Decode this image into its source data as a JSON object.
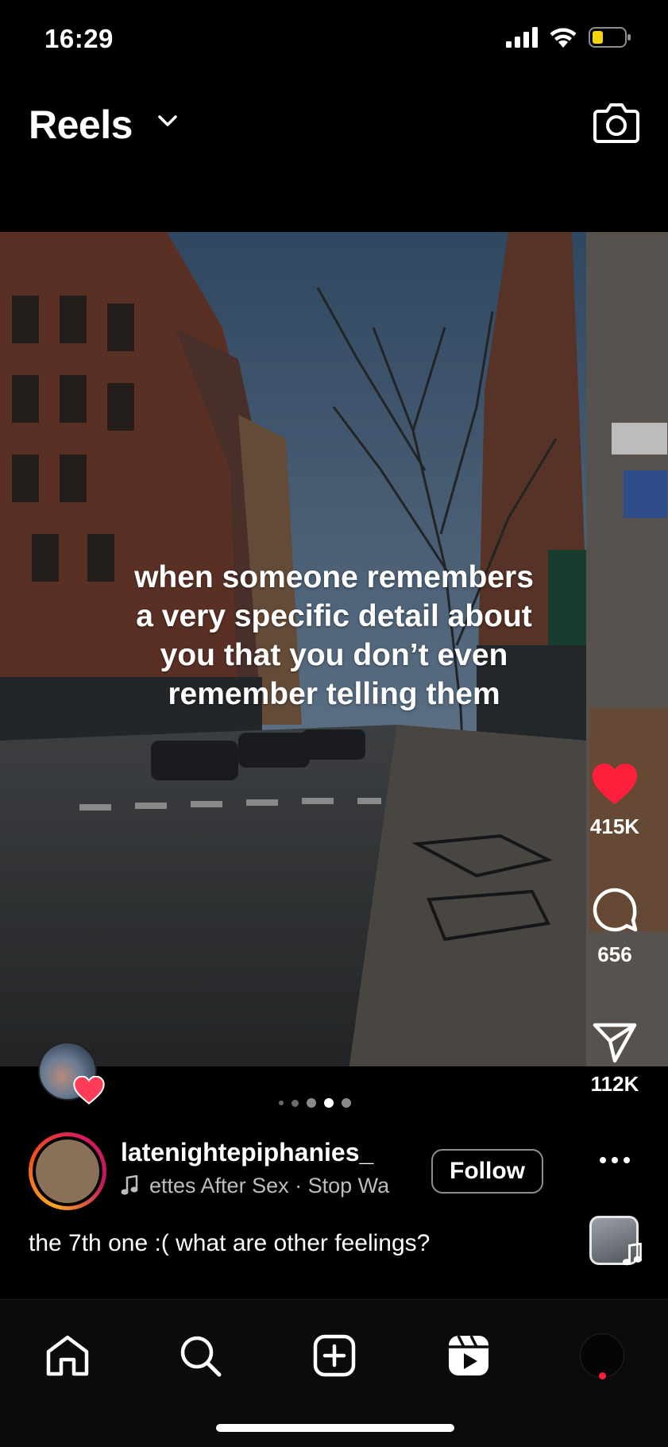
{
  "status_bar": {
    "time": "16:29",
    "icons": [
      "cellular-signal-icon",
      "wifi-icon",
      "battery-icon"
    ],
    "battery_color": "#f5d50a"
  },
  "header": {
    "title": "Reels",
    "icons": [
      "chevron-down-icon",
      "camera-icon"
    ]
  },
  "reel": {
    "overlay_lines": [
      "when someone remembers",
      "a very specific detail about",
      "you that you don’t even",
      "remember telling them"
    ],
    "page_indicator": {
      "count": 5,
      "active": 3
    }
  },
  "actions": {
    "likes": "415K",
    "comments": "656",
    "shares": "112K",
    "like_color": "#ff1f3d"
  },
  "author": {
    "username": "latenightepiphanies_",
    "audio": "ettes After Sex · Stop Wa",
    "follow_label": "Follow"
  },
  "caption": "the 7th one :( what are other feelings?",
  "tab_bar": {
    "items": [
      "home-icon",
      "search-icon",
      "create-icon",
      "reels-icon",
      "profile-avatar"
    ],
    "notification_color": "#ff1f3d"
  }
}
